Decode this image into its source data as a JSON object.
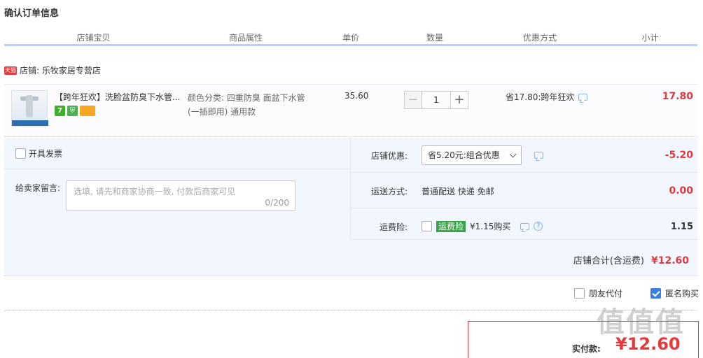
{
  "page": {
    "title": "确认订单信息"
  },
  "columns": [
    "店铺宝贝",
    "商品属性",
    "单价",
    "数量",
    "优惠方式",
    "小计"
  ],
  "shop": {
    "badge": "天猫",
    "label": "店铺: 乐牧家居专营店"
  },
  "item": {
    "title": "【跨年狂欢】洗脸盆防臭下水管...",
    "attr_line1": "颜色分类: 四重防臭 面盆下水管",
    "attr_line2": "(一插即用) 通用款",
    "price": "35.60",
    "quantity": "1",
    "qty_minus": "−",
    "qty_plus": "+",
    "discount": "省17.80:跨年狂欢",
    "subtotal": "17.80",
    "badge_7": "7",
    "badge_shield": "⛨"
  },
  "invoice": {
    "label": "开具发票"
  },
  "message": {
    "label": "给卖家留言:",
    "placeholder": "选填, 请先和商家协商一致, 付款后商家可见",
    "count": "0/200"
  },
  "shop_discount": {
    "label": "店铺优惠:",
    "selected": "省5.20元:组合优惠",
    "amount": "-5.20"
  },
  "shipping": {
    "label": "运送方式:",
    "value": "普通配送 快递 免邮",
    "amount": "0.00"
  },
  "insurance": {
    "label": "运费险:",
    "tag": "运费险",
    "value": "¥1.15购买",
    "amount": "1.15",
    "help": "?"
  },
  "shop_total": {
    "label": "店铺合计(含运费)",
    "value": "¥12.60"
  },
  "options": {
    "friend_pay": "朋友代付",
    "anonymous": "匿名购买"
  },
  "payment": {
    "label": "实付款:",
    "value": "¥12.60"
  },
  "watermark": "值值值"
}
